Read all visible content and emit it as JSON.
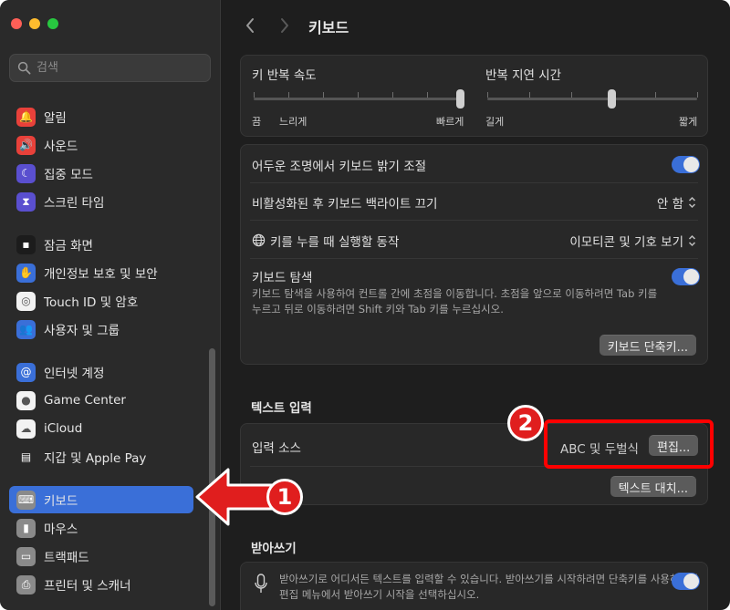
{
  "window": {
    "title": "키보드"
  },
  "search": {
    "placeholder": "검색"
  },
  "sidebar": {
    "items": [
      {
        "label": "알림",
        "icon": "bell-icon",
        "color": "#e8413a"
      },
      {
        "label": "사운드",
        "icon": "speaker-icon",
        "color": "#e8413a"
      },
      {
        "label": "집중 모드",
        "icon": "moon-icon",
        "color": "#5a4fcf"
      },
      {
        "label": "스크린 타임",
        "icon": "hourglass-icon",
        "color": "#5a4fcf"
      },
      {
        "label": "잠금 화면",
        "icon": "lock-screen-icon",
        "color": "#1c1c1c"
      },
      {
        "label": "개인정보 보호 및 보안",
        "icon": "hand-icon",
        "color": "#3a6fd8"
      },
      {
        "label": "Touch ID 및 암호",
        "icon": "fingerprint-icon",
        "color": "#f2f2f2"
      },
      {
        "label": "사용자 및 그룹",
        "icon": "users-icon",
        "color": "#3a6fd8"
      },
      {
        "label": "인터넷 계정",
        "icon": "at-icon",
        "color": "#3a6fd8"
      },
      {
        "label": "Game Center",
        "icon": "game-center-icon",
        "color": "#f2f2f2"
      },
      {
        "label": "iCloud",
        "icon": "cloud-icon",
        "color": "#f2f2f2"
      },
      {
        "label": "지갑 및 Apple Pay",
        "icon": "wallet-icon",
        "color": "#2a2a2a"
      },
      {
        "label": "키보드",
        "icon": "keyboard-icon",
        "color": "#8a8a8a",
        "selected": true
      },
      {
        "label": "마우스",
        "icon": "mouse-icon",
        "color": "#8a8a8a"
      },
      {
        "label": "트랙패드",
        "icon": "trackpad-icon",
        "color": "#8a8a8a"
      },
      {
        "label": "프린터 및 스캐너",
        "icon": "printer-icon",
        "color": "#8a8a8a"
      }
    ]
  },
  "sliders": {
    "repeat_rate": {
      "title": "키 반복 속도",
      "min_label": "끔",
      "mid_label": "느리게",
      "max_label": "빠르게",
      "value": 1.0
    },
    "repeat_delay": {
      "title": "반복 지연 시간",
      "min_label": "길게",
      "max_label": "짧게",
      "value": 0.6
    }
  },
  "settings": {
    "backlight_adjust": {
      "label": "어두운 조명에서 키보드 밝기 조절",
      "on": true
    },
    "backlight_off": {
      "label": "비활성화된 후 키보드 백라이트 끄기",
      "value": "안 함"
    },
    "globe_key": {
      "label": "키를 누를 때 실행할 동작",
      "value": "이모티콘 및 기호 보기"
    },
    "keyboard_nav": {
      "label": "키보드 탐색",
      "on": true,
      "desc_line1": "키보드 탐색을 사용하여 컨트롤 간에 초점을 이동합니다. 초점을 앞으로 이동하려면 Tab 키를",
      "desc_line2": "누르고 뒤로 이동하려면 Shift 키와 Tab 키를 누르십시오."
    },
    "shortcuts_button": "키보드 단축키..."
  },
  "text_input": {
    "section_title": "텍스트 입력",
    "input_sources_label": "입력 소스",
    "input_sources_value": "ABC 및 두벌식",
    "edit_button": "편집...",
    "replacements_button": "텍스트 대치..."
  },
  "dictation": {
    "section_title": "받아쓰기",
    "on": true,
    "desc_line1": "받아쓰기로 어디서든 텍스트를 입력할 수 있습니다. 받아쓰기를 시작하려면 단축키를 사용하거나",
    "desc_line2": "편집 메뉴에서 받아쓰기 시작을 선택하십시오."
  },
  "annotations": {
    "step1": "1",
    "step2": "2",
    "color": "#e01e1e"
  }
}
